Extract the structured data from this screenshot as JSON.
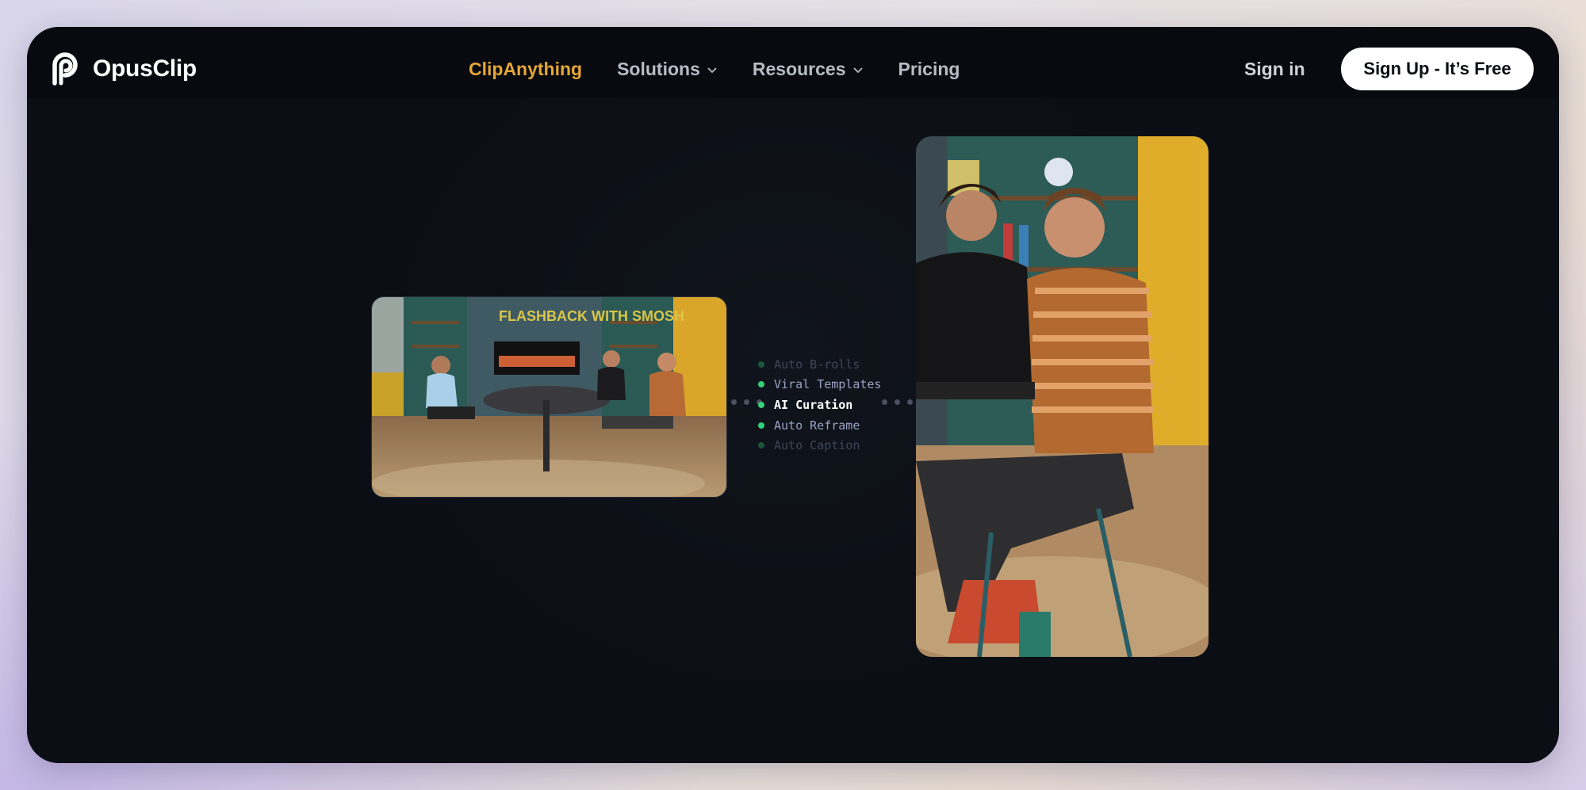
{
  "brand": {
    "name": "OpusClip"
  },
  "nav": {
    "links": [
      {
        "label": "ClipAnything",
        "active": true,
        "dropdown": false
      },
      {
        "label": "Solutions",
        "active": false,
        "dropdown": true
      },
      {
        "label": "Resources",
        "active": false,
        "dropdown": true
      },
      {
        "label": "Pricing",
        "active": false,
        "dropdown": false
      }
    ],
    "signin": "Sign in",
    "signup": "Sign Up - It’s Free"
  },
  "hero": {
    "features": [
      {
        "label": "Auto B-rolls",
        "state": "faded"
      },
      {
        "label": "Viral Templates",
        "state": "normal"
      },
      {
        "label": "AI Curation",
        "state": "active"
      },
      {
        "label": "Auto Reframe",
        "state": "normal"
      },
      {
        "label": "Auto Caption",
        "state": "faded"
      }
    ],
    "sign_text": "FLASHBACK WITH SMOSH"
  },
  "colors": {
    "accent": "#e5a736",
    "background": "#0b0e14",
    "nav_bg": "#090a0f",
    "feature_dot": "#35d07a"
  }
}
